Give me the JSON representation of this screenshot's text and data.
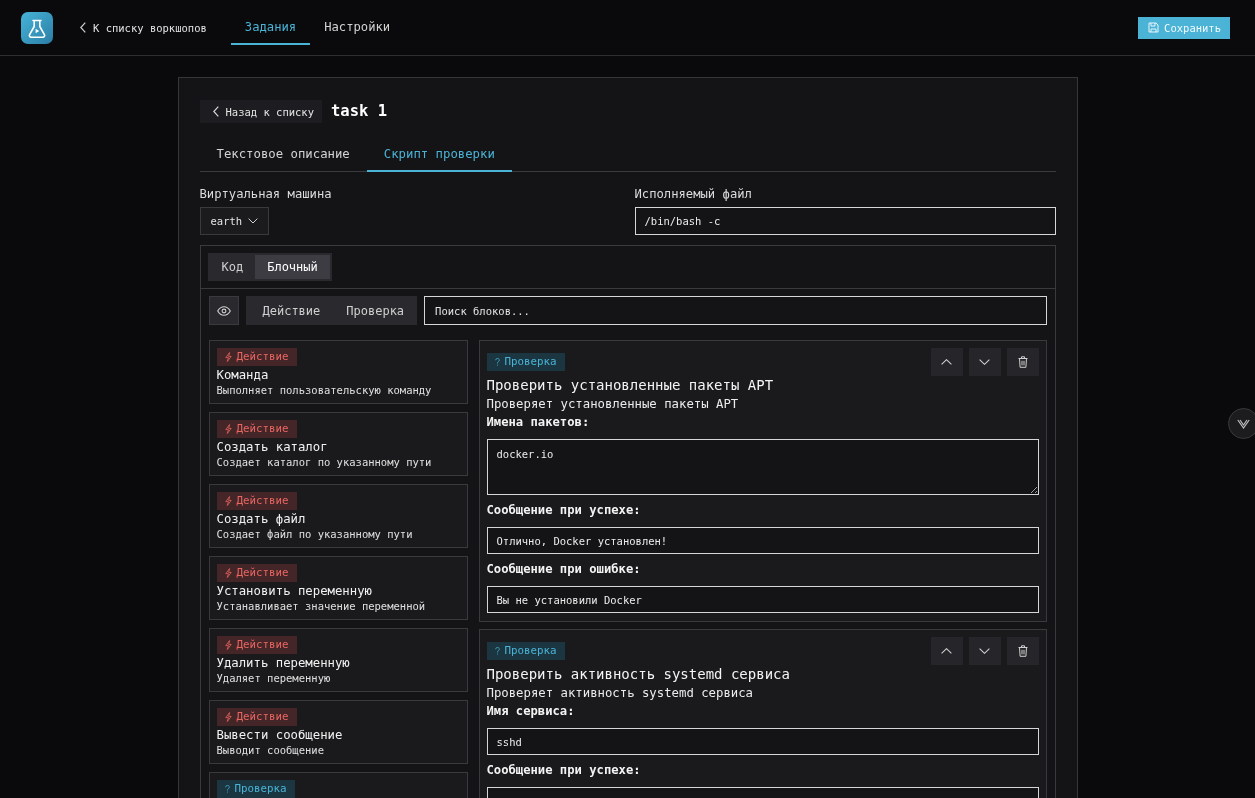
{
  "header": {
    "back_link": "К списку воркшопов",
    "tabs": [
      {
        "label": "Задания",
        "selected": true
      },
      {
        "label": "Настройки",
        "selected": false
      }
    ],
    "save_button": "Сохранить"
  },
  "task": {
    "back_button": "Назад к списку",
    "title": "task 1"
  },
  "tabs": [
    {
      "label": "Текстовое описание",
      "selected": false
    },
    {
      "label": "Скрипт проверки",
      "selected": true
    }
  ],
  "settings": {
    "vm": {
      "label": "Виртуальная машина",
      "value": "earth"
    },
    "executable": {
      "label": "Исполняемый файл",
      "value": "/bin/bash -c"
    }
  },
  "editor": {
    "modes": [
      {
        "label": "Код",
        "selected": false
      },
      {
        "label": "Блочный",
        "selected": true
      }
    ],
    "filters": [
      {
        "label": "Действие",
        "selected": false
      },
      {
        "label": "Проверка",
        "selected": false
      }
    ],
    "search": {
      "placeholder": "Поиск блоков..."
    },
    "palette": [
      {
        "kind": "action",
        "badge": "Действие",
        "title": "Команда",
        "description": "Выполняет пользовательскую команду"
      },
      {
        "kind": "action",
        "badge": "Действие",
        "title": "Создать каталог",
        "description": "Создает каталог по указанному пути"
      },
      {
        "kind": "action",
        "badge": "Действие",
        "title": "Создать файл",
        "description": "Создает файл по указанному пути"
      },
      {
        "kind": "action",
        "badge": "Действие",
        "title": "Установить переменную",
        "description": "Устанавливает значение переменной"
      },
      {
        "kind": "action",
        "badge": "Действие",
        "title": "Удалить переменную",
        "description": "Удаляет переменную"
      },
      {
        "kind": "action",
        "badge": "Действие",
        "title": "Вывести сообщение",
        "description": "Выводит сообщение"
      },
      {
        "kind": "check",
        "badge": "Проверка"
      }
    ],
    "blocks": [
      {
        "kind": "check",
        "badge": "Проверка",
        "title": "Проверить установленные пакеты APT",
        "description": "Проверяет установленные пакеты APT",
        "fields": [
          {
            "kind": "textarea",
            "label": "Имена пакетов:",
            "value": "docker.io"
          },
          {
            "kind": "input",
            "label": "Сообщение при успехе:",
            "value": "Отлично, Docker установлен!"
          },
          {
            "kind": "input",
            "label": "Сообщение при ошибке:",
            "value": "Вы не установили Docker"
          }
        ]
      },
      {
        "kind": "check",
        "badge": "Проверка",
        "title": "Проверить активность systemd сервиса",
        "description": "Проверяет активность systemd сервиса",
        "fields": [
          {
            "kind": "input",
            "label": "Имя сервиса:",
            "value": "sshd"
          },
          {
            "kind": "input",
            "label": "Сообщение при успехе:"
          }
        ]
      }
    ]
  }
}
